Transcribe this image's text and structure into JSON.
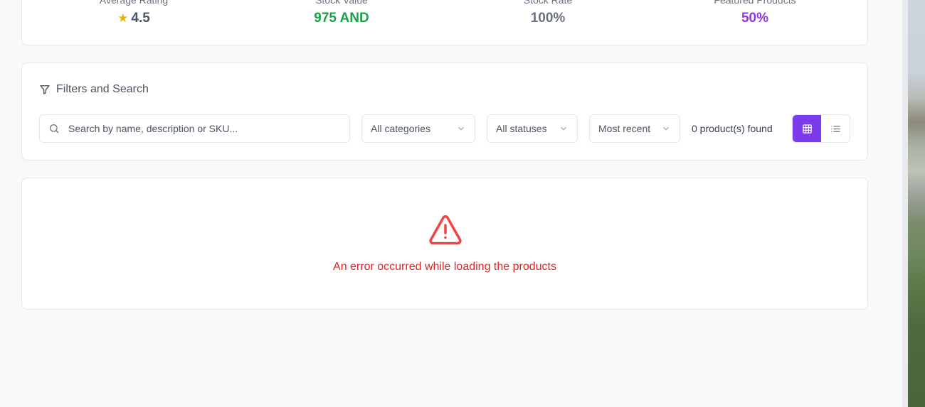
{
  "stats": [
    {
      "label": "Average Rating",
      "value": "4.5",
      "icon": "star-icon",
      "color": "#4b5563"
    },
    {
      "label": "Stock Value",
      "value": "975 AND",
      "color": "#16a34a"
    },
    {
      "label": "Stock Rate",
      "value": "100%",
      "color": "#6b7280"
    },
    {
      "label": "Featured Products",
      "value": "50%",
      "color": "#9333ea"
    }
  ],
  "filters": {
    "title": "Filters and Search",
    "search_placeholder": "Search by name, description or SKU...",
    "category": "All categories",
    "status": "All statuses",
    "sort": "Most recent",
    "found": "0 product(s) found"
  },
  "error": {
    "message": "An error occurred while loading the products",
    "icon": "warning-triangle-icon",
    "color": "#dc2626"
  },
  "colors": {
    "accent": "#7c3aed",
    "background": "#f8f9fb"
  }
}
